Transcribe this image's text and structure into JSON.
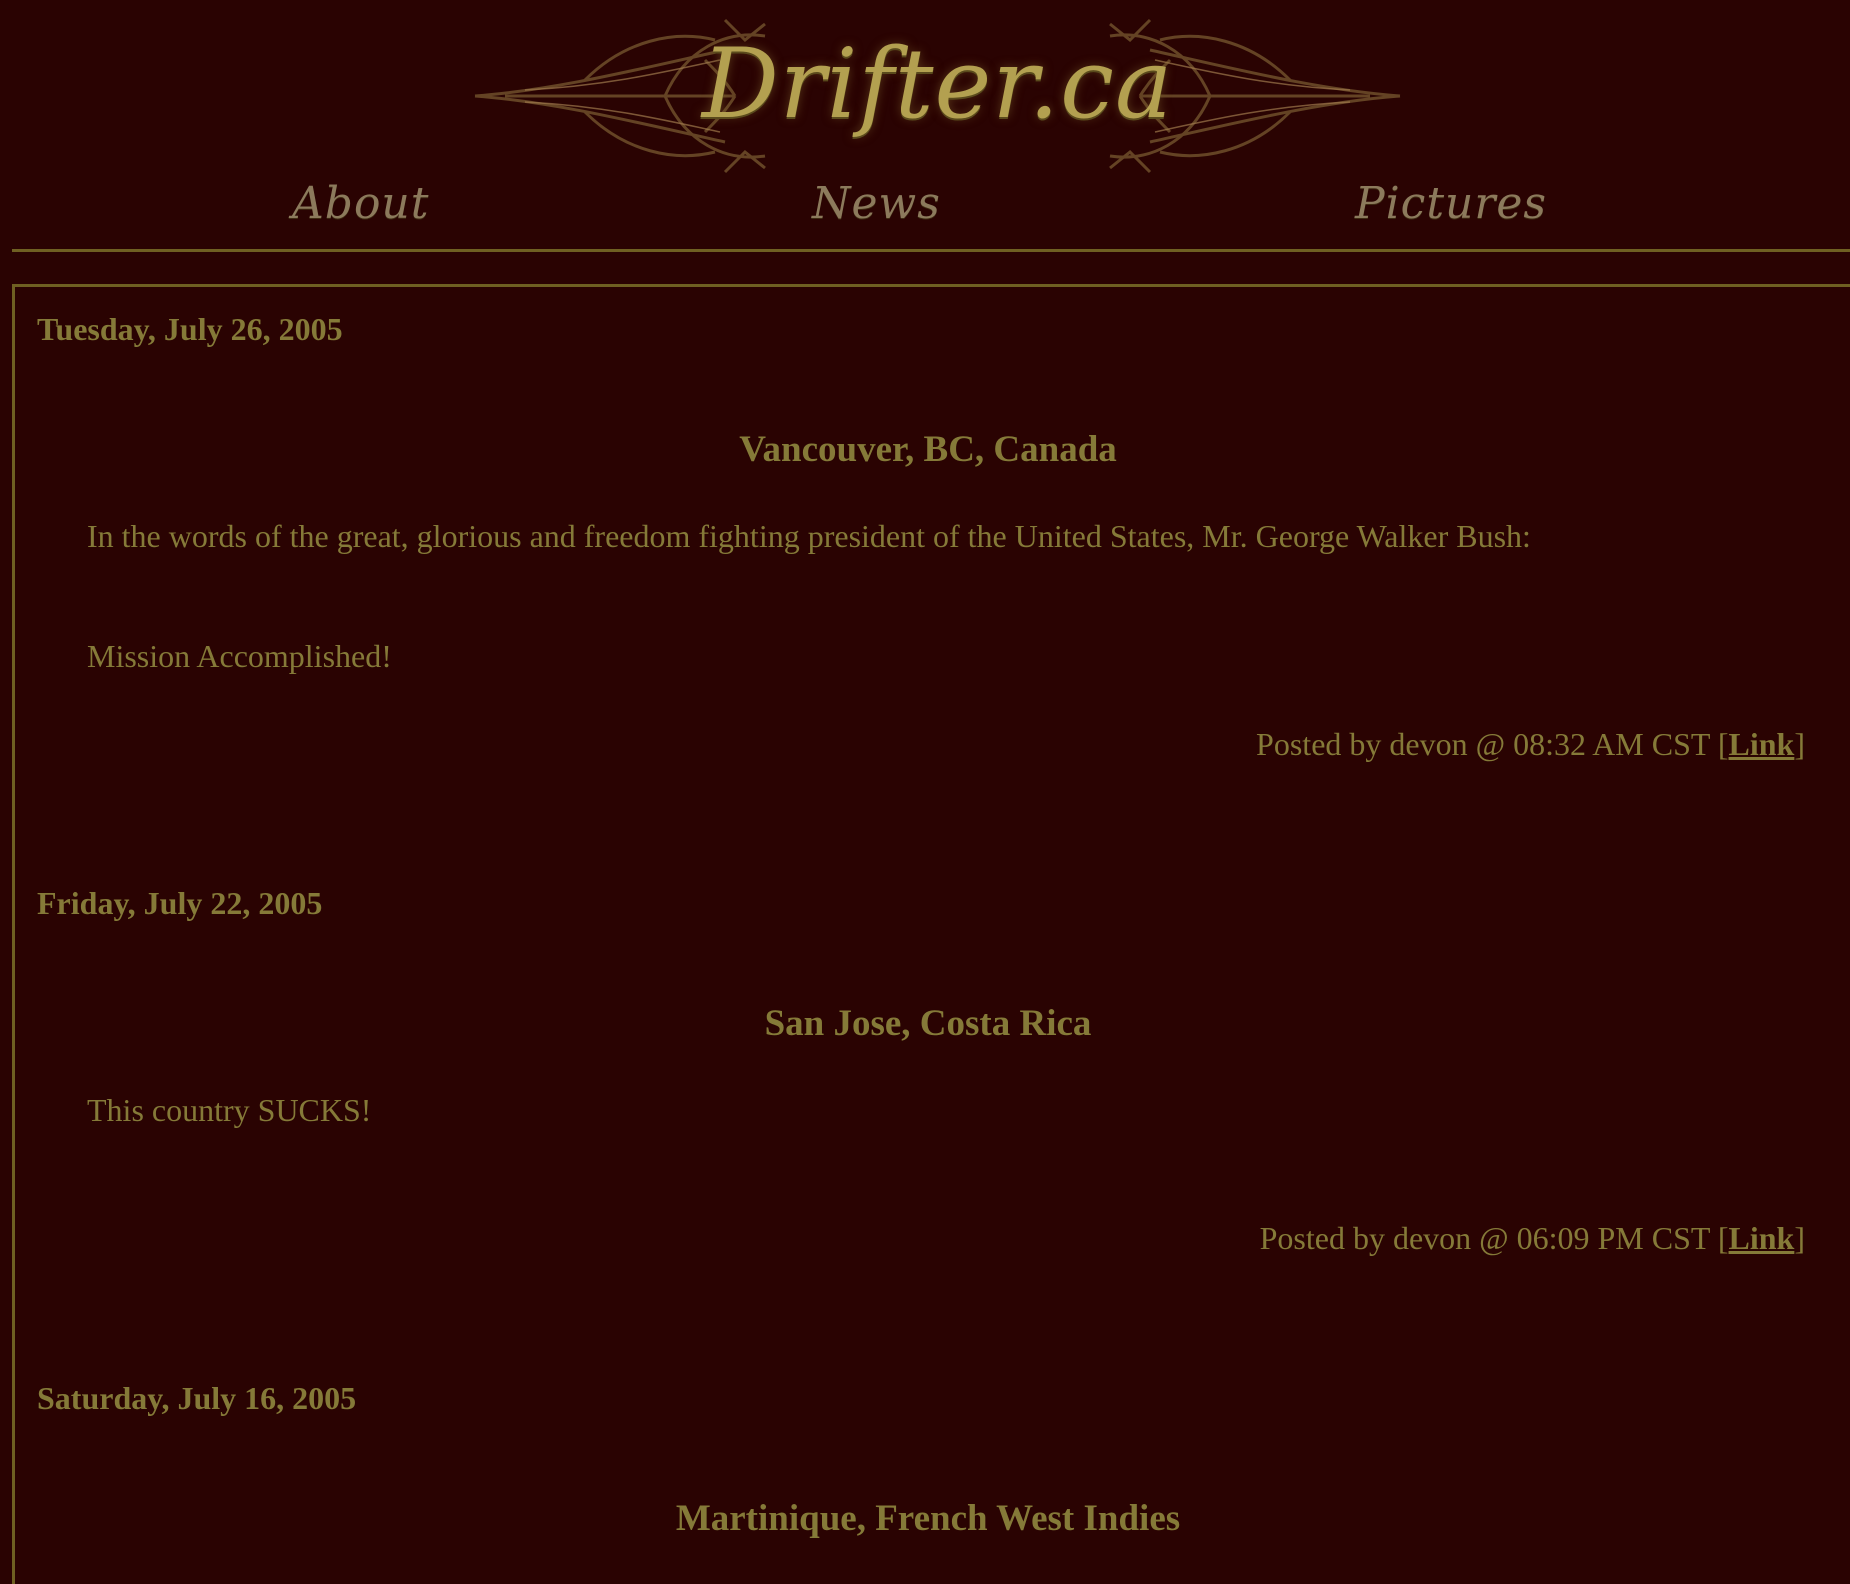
{
  "site": {
    "logo_text": "Drifter.ca"
  },
  "nav": {
    "items": [
      {
        "label": "About"
      },
      {
        "label": "News"
      },
      {
        "label": "Pictures"
      }
    ]
  },
  "entries": [
    {
      "date": "Tuesday, July 26, 2005",
      "location": "Vancouver, BC, Canada",
      "paragraphs": [
        "In the words of the great, glorious and freedom fighting president of the United States, Mr. George Walker Bush:",
        "Mission Accomplished!"
      ],
      "posted_prefix": "Posted by devon @ 08:32 AM CST [",
      "link_label": "Link",
      "posted_suffix": "]"
    },
    {
      "date": "Friday, July 22, 2005",
      "location": "San Jose, Costa Rica",
      "paragraphs": [
        "This country SUCKS!"
      ],
      "posted_prefix": "Posted by devon @ 06:09 PM CST [",
      "link_label": "Link",
      "posted_suffix": "]"
    },
    {
      "date": "Saturday, July 16, 2005",
      "location": "Martinique, French West Indies"
    }
  ],
  "colors": {
    "background": "#2a0302",
    "text": "#857a38",
    "rule": "#6f6022",
    "logo": "#b3a050"
  }
}
